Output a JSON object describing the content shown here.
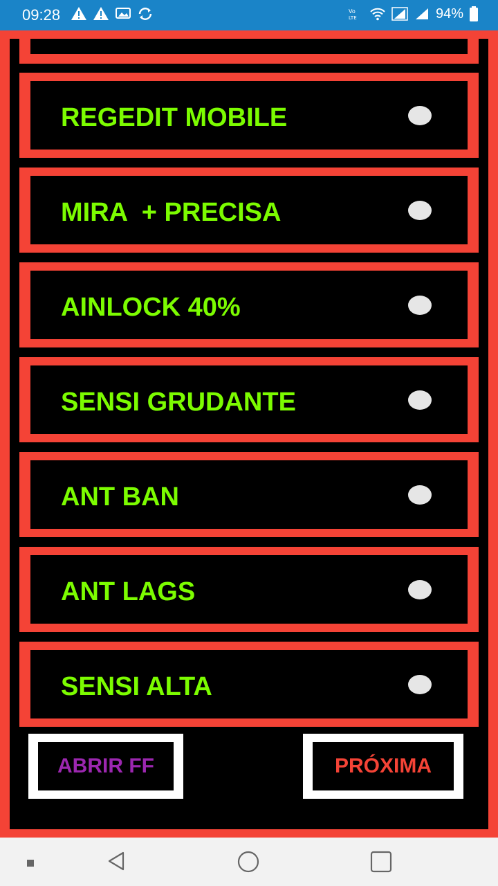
{
  "status_bar": {
    "time": "09:28",
    "battery": "94%",
    "left_icons": [
      "warning-icon",
      "warning-icon",
      "gallery-icon",
      "sync-icon"
    ],
    "right_icons": [
      "volte-icon",
      "wifi-icon",
      "signal-icon",
      "signal-icon",
      "battery-icon"
    ]
  },
  "options": [
    {
      "label": "REGEDIT MOBILE",
      "selected": false
    },
    {
      "label": "MIRA  + PRECISA",
      "selected": false
    },
    {
      "label": "AINLOCK 40%",
      "selected": false
    },
    {
      "label": "SENSI GRUDANTE",
      "selected": false
    },
    {
      "label": "ANT BAN",
      "selected": false
    },
    {
      "label": "ANT LAGS",
      "selected": false
    },
    {
      "label": "SENSI ALTA",
      "selected": false
    }
  ],
  "buttons": {
    "open_ff": "ABRIR FF",
    "next": "PRÓXIMA"
  },
  "colors": {
    "accent_red": "#f44336",
    "label_green": "#7cfc00",
    "open_purple": "#9c27b0",
    "next_red": "#f44336",
    "status_blue": "#1a84c8"
  },
  "nav_bar": {
    "items": [
      "recents-dot-icon",
      "back-icon",
      "home-icon",
      "overview-icon"
    ]
  }
}
